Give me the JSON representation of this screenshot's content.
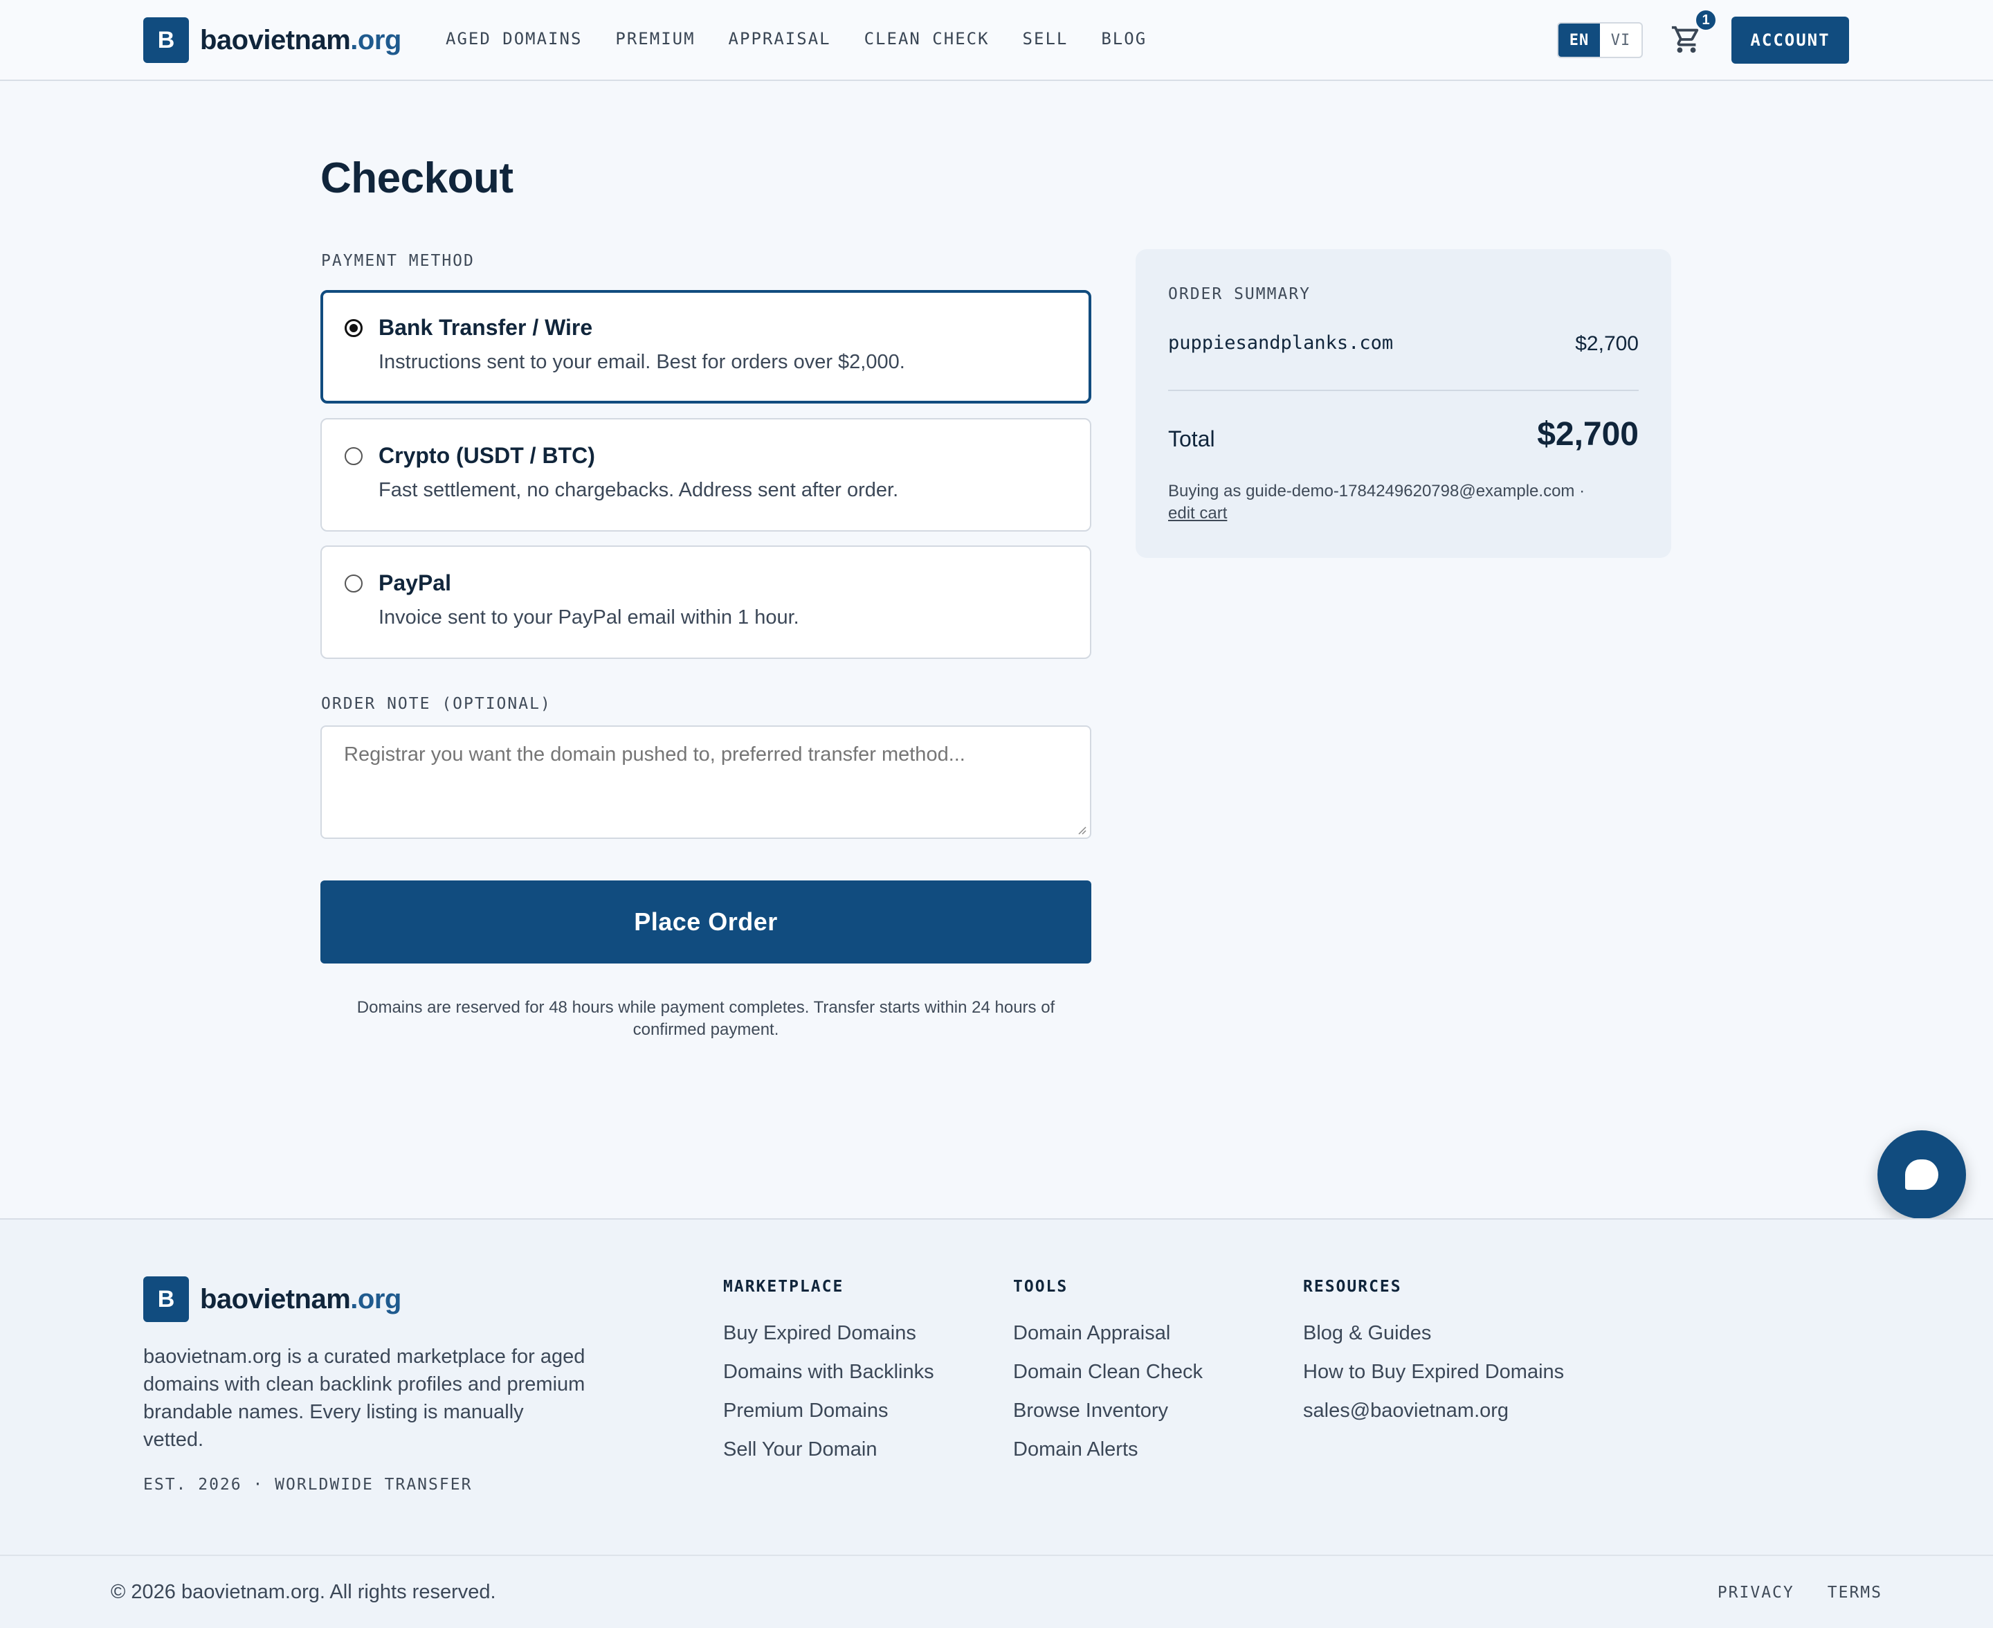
{
  "header": {
    "logo_letter": "B",
    "logo_name": "baovietnam",
    "logo_tld": ".org",
    "nav": [
      "AGED DOMAINS",
      "PREMIUM",
      "APPRAISAL",
      "CLEAN CHECK",
      "SELL",
      "BLOG"
    ],
    "lang_active": "EN",
    "lang_inactive": "VI",
    "cart_count": "1",
    "account_label": "ACCOUNT"
  },
  "main": {
    "title": "Checkout",
    "payment_label": "PAYMENT METHOD",
    "payment_options": [
      {
        "title": "Bank Transfer / Wire",
        "desc": "Instructions sent to your email. Best for orders over $2,000.",
        "selected": true
      },
      {
        "title": "Crypto (USDT / BTC)",
        "desc": "Fast settlement, no chargebacks. Address sent after order.",
        "selected": false
      },
      {
        "title": "PayPal",
        "desc": "Invoice sent to your PayPal email within 1 hour.",
        "selected": false
      }
    ],
    "note_label": "ORDER NOTE (OPTIONAL)",
    "note_placeholder": "Registrar you want the domain pushed to, preferred transfer method...",
    "place_order": "Place Order",
    "reserve_note": "Domains are reserved for 48 hours while payment completes. Transfer starts within 24 hours of confirmed payment."
  },
  "summary": {
    "label": "ORDER SUMMARY",
    "domain": "puppiesandplanks.com",
    "price": "$2,700",
    "total_label": "Total",
    "total": "$2,700",
    "buying_as": "Buying as guide-demo-1784249620798@example.com ·",
    "edit_cart": "edit cart"
  },
  "footer": {
    "logo_letter": "B",
    "logo_name": "baovietnam",
    "logo_tld": ".org",
    "about": "baovietnam.org is a curated marketplace for aged domains with clean backlink profiles and premium brandable names. Every listing is manually vetted.",
    "est": "EST. 2026 · WORLDWIDE TRANSFER",
    "columns": [
      {
        "title": "MARKETPLACE",
        "links": [
          "Buy Expired Domains",
          "Domains with Backlinks",
          "Premium Domains",
          "Sell Your Domain"
        ]
      },
      {
        "title": "TOOLS",
        "links": [
          "Domain Appraisal",
          "Domain Clean Check",
          "Browse Inventory",
          "Domain Alerts"
        ]
      },
      {
        "title": "RESOURCES",
        "links": [
          "Blog & Guides",
          "How to Buy Expired Domains",
          "sales@baovietnam.org"
        ]
      }
    ],
    "copyright": "© 2026 baovietnam.org. All rights reserved.",
    "legal": [
      "PRIVACY",
      "TERMS"
    ]
  },
  "colors": {
    "brand": "#114c7f",
    "text": "#10253b",
    "background": "#f5f8fc"
  },
  "icons": {
    "cart": "shopping-cart-icon",
    "chat": "chat-bubble-icon"
  }
}
